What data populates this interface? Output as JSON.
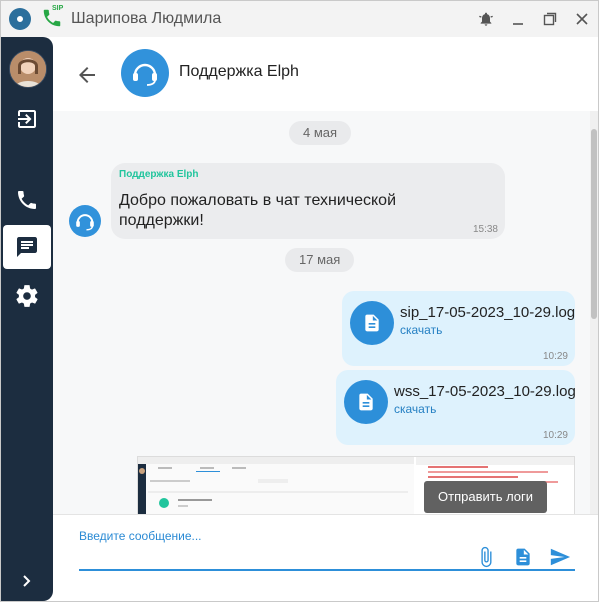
{
  "window": {
    "title": "Шарипова Людмила",
    "sip_badge": "SIP"
  },
  "chat": {
    "contact_name": "Поддержка Elph"
  },
  "messages": {
    "dates": [
      "4 мая",
      "17 мая"
    ],
    "welcome": {
      "sender": "Поддержка Elph",
      "text": "Добро пожаловать в чат технической поддержки!",
      "time": "15:38"
    },
    "files": [
      {
        "name": "sip_17-05-2023_10-29.log",
        "download_label": "скачать",
        "time": "10:29"
      },
      {
        "name": "wss_17-05-2023_10-29.log",
        "download_label": "скачать",
        "time": "10:29"
      }
    ],
    "tooltip": "Отправить логи"
  },
  "composer": {
    "placeholder": "Введите сообщение..."
  },
  "colors": {
    "sidebar": "#1c2d40",
    "accent": "#2d8fd9",
    "outgoing_bubble": "#def2fd",
    "sender_name": "#21c59d"
  }
}
